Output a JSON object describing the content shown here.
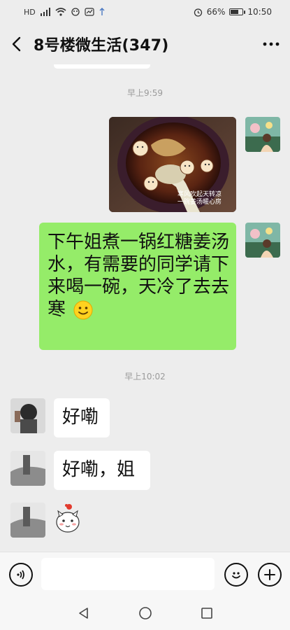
{
  "status_bar": {
    "left_badges": [
      "HD",
      "4G",
      "HD"
    ],
    "battery": "66%",
    "battery_level": 0.66,
    "time": "10:50"
  },
  "header": {
    "title": "8号楼微生活(347)",
    "back_icon": "chevron-left-icon",
    "more_icon": "more-dots-icon"
  },
  "messages": {
    "timestamp1": "早上9:59",
    "image_caption_line1": "寒风吹起天转凉",
    "image_caption_line2": "一碗姜汤暖心房",
    "outgoing_text": "下午姐煮一锅红糖姜汤水，有需要的同学请下来喝一碗，天冷了去去寒",
    "timestamp2": "早上10:02",
    "reply1": "好嘞",
    "reply2": "好嘞，姐"
  },
  "input_bar": {
    "voice_icon": "voice-icon",
    "emoji_icon": "emoji-icon",
    "plus_icon": "plus-icon",
    "placeholder": ""
  },
  "nav": {
    "back": "nav-back-icon",
    "home": "nav-home-icon",
    "recent": "nav-recent-icon"
  },
  "colors": {
    "background": "#ededed",
    "outgoing_bubble": "#95ec69",
    "incoming_bubble": "#ffffff",
    "timestamp": "#9b9b9b"
  }
}
